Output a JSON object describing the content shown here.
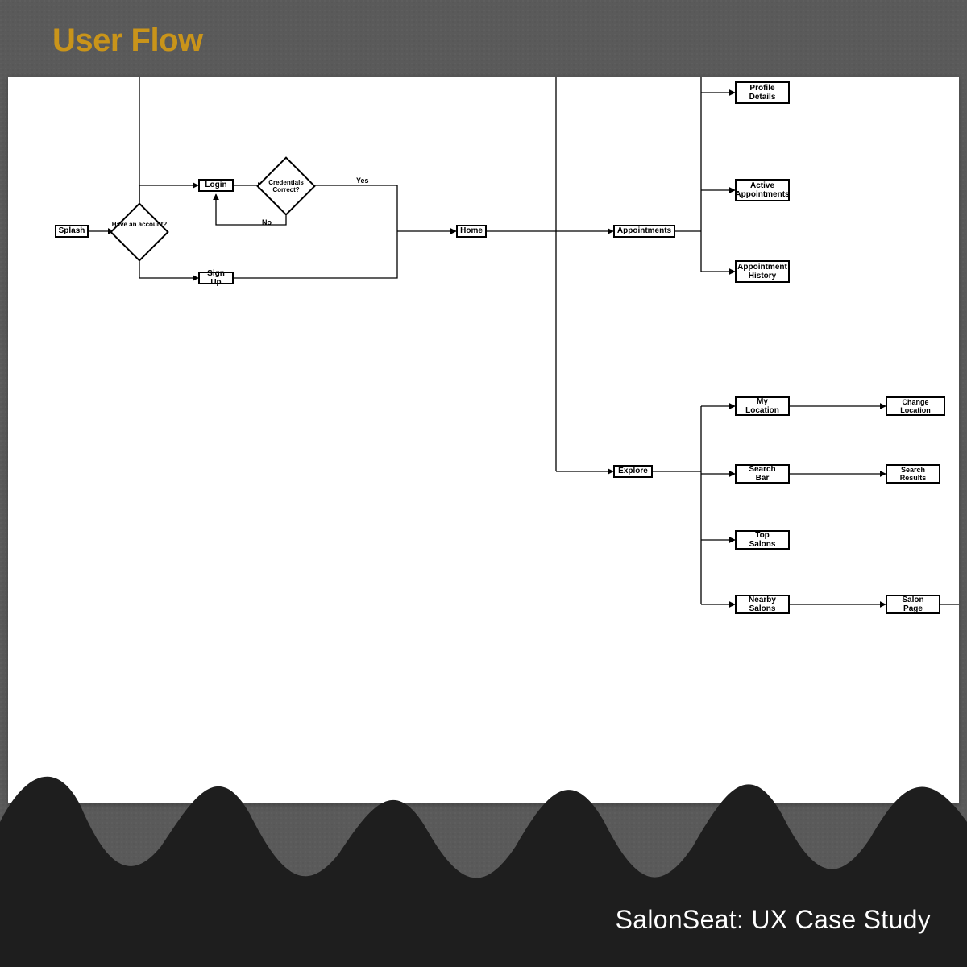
{
  "header": {
    "title": "User Flow"
  },
  "footer": {
    "caption": "SalonSeat: UX Case Study"
  },
  "flow": {
    "nodes": {
      "splash": "Splash",
      "have_account": "Have\nan\naccount?",
      "login": "Login",
      "credentials": "Credentials\nCorrect?",
      "signup": "Sign Up",
      "home": "Home",
      "appointments": "Appointments",
      "profile_details": "Profile\nDetails",
      "active_appts": "Active\nAppointments",
      "appt_history": "Appointment\nHistory",
      "explore": "Explore",
      "my_location": "My Location",
      "change_location": "Change Location",
      "search_bar": "Search Bar",
      "search_results": "Search Results",
      "top_salons": "Top Salons",
      "nearby_salons": "Nearby Salons",
      "salon_page": "Salon Page"
    },
    "edge_labels": {
      "yes": "Yes",
      "no": "No"
    }
  },
  "chart_data": {
    "type": "flowchart",
    "title": "User Flow",
    "nodes": [
      {
        "id": "splash",
        "label": "Splash",
        "shape": "rect"
      },
      {
        "id": "have_account",
        "label": "Have an account?",
        "shape": "diamond"
      },
      {
        "id": "login",
        "label": "Login",
        "shape": "rect"
      },
      {
        "id": "credentials",
        "label": "Credentials Correct?",
        "shape": "diamond"
      },
      {
        "id": "signup",
        "label": "Sign Up",
        "shape": "rect"
      },
      {
        "id": "home",
        "label": "Home",
        "shape": "rect"
      },
      {
        "id": "appointments",
        "label": "Appointments",
        "shape": "rect"
      },
      {
        "id": "profile_details",
        "label": "Profile Details",
        "shape": "rect"
      },
      {
        "id": "active_appts",
        "label": "Active Appointments",
        "shape": "rect"
      },
      {
        "id": "appt_history",
        "label": "Appointment History",
        "shape": "rect"
      },
      {
        "id": "explore",
        "label": "Explore",
        "shape": "rect"
      },
      {
        "id": "my_location",
        "label": "My Location",
        "shape": "rect"
      },
      {
        "id": "change_location",
        "label": "Change Location",
        "shape": "rect"
      },
      {
        "id": "search_bar",
        "label": "Search Bar",
        "shape": "rect"
      },
      {
        "id": "search_results",
        "label": "Search Results",
        "shape": "rect"
      },
      {
        "id": "top_salons",
        "label": "Top Salons",
        "shape": "rect"
      },
      {
        "id": "nearby_salons",
        "label": "Nearby Salons",
        "shape": "rect"
      },
      {
        "id": "salon_page",
        "label": "Salon Page",
        "shape": "rect"
      }
    ],
    "edges": [
      {
        "from": "splash",
        "to": "have_account"
      },
      {
        "from": "have_account",
        "to": "login"
      },
      {
        "from": "have_account",
        "to": "signup"
      },
      {
        "from": "login",
        "to": "credentials"
      },
      {
        "from": "credentials",
        "to": "home",
        "label": "Yes"
      },
      {
        "from": "credentials",
        "to": "login",
        "label": "No"
      },
      {
        "from": "signup",
        "to": "home"
      },
      {
        "from": "home",
        "to": "appointments"
      },
      {
        "from": "home",
        "to": "explore"
      },
      {
        "from": "appointments",
        "to": "profile_details"
      },
      {
        "from": "appointments",
        "to": "active_appts"
      },
      {
        "from": "appointments",
        "to": "appt_history"
      },
      {
        "from": "explore",
        "to": "my_location"
      },
      {
        "from": "explore",
        "to": "search_bar"
      },
      {
        "from": "explore",
        "to": "top_salons"
      },
      {
        "from": "explore",
        "to": "nearby_salons"
      },
      {
        "from": "my_location",
        "to": "change_location"
      },
      {
        "from": "search_bar",
        "to": "search_results"
      },
      {
        "from": "nearby_salons",
        "to": "salon_page"
      }
    ]
  }
}
